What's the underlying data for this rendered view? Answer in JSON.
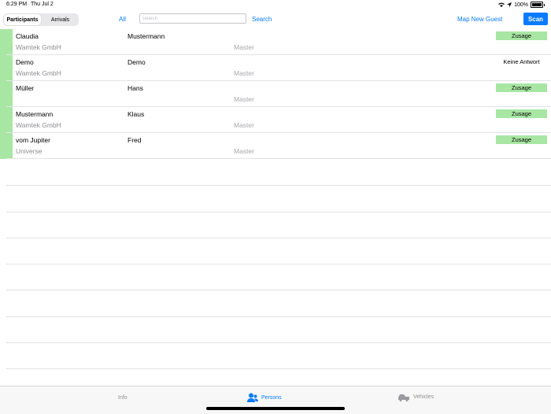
{
  "status_bar": {
    "time": "6:29 PM",
    "date": "Thu Jul 2",
    "battery": "100%"
  },
  "toolbar": {
    "segments": [
      {
        "label": "Participants",
        "active": true
      },
      {
        "label": "Arrivals",
        "active": false
      }
    ],
    "all_label": "All",
    "search_placeholder": "Search",
    "search_value": "",
    "search_label": "Search",
    "map_guest_label": "Map New Guest",
    "scan_label": "Scan"
  },
  "rows": [
    {
      "last_name": "Claudia",
      "first_name": "Mustermann",
      "company": "Wamtek GmbH",
      "role": "Master",
      "status": "Zusage",
      "status_type": "zusage"
    },
    {
      "last_name": "Demo",
      "first_name": "Demo",
      "company": "Wamtek GmbH",
      "role": "Master",
      "status": "Keine Antwort",
      "status_type": "none"
    },
    {
      "last_name": "Müller",
      "first_name": "Hans",
      "company": "",
      "role": "Master",
      "status": "Zusage",
      "status_type": "zusage"
    },
    {
      "last_name": "Mustermann",
      "first_name": "Klaus",
      "company": "Wamtek GmbH",
      "role": "Master",
      "status": "Zusage",
      "status_type": "zusage"
    },
    {
      "last_name": "vom Jupiter",
      "first_name": "Fred",
      "company": "Universe",
      "role": "Master",
      "status": "Zusage",
      "status_type": "zusage"
    }
  ],
  "tabs": [
    {
      "label": "Info",
      "icon": "info-icon",
      "active": false
    },
    {
      "label": "Persons",
      "icon": "persons-icon",
      "active": true
    },
    {
      "label": "Vehicles",
      "icon": "vehicles-icon",
      "active": false
    }
  ],
  "colors": {
    "accent": "#0a7bff",
    "status_green": "#a8e6a3"
  }
}
